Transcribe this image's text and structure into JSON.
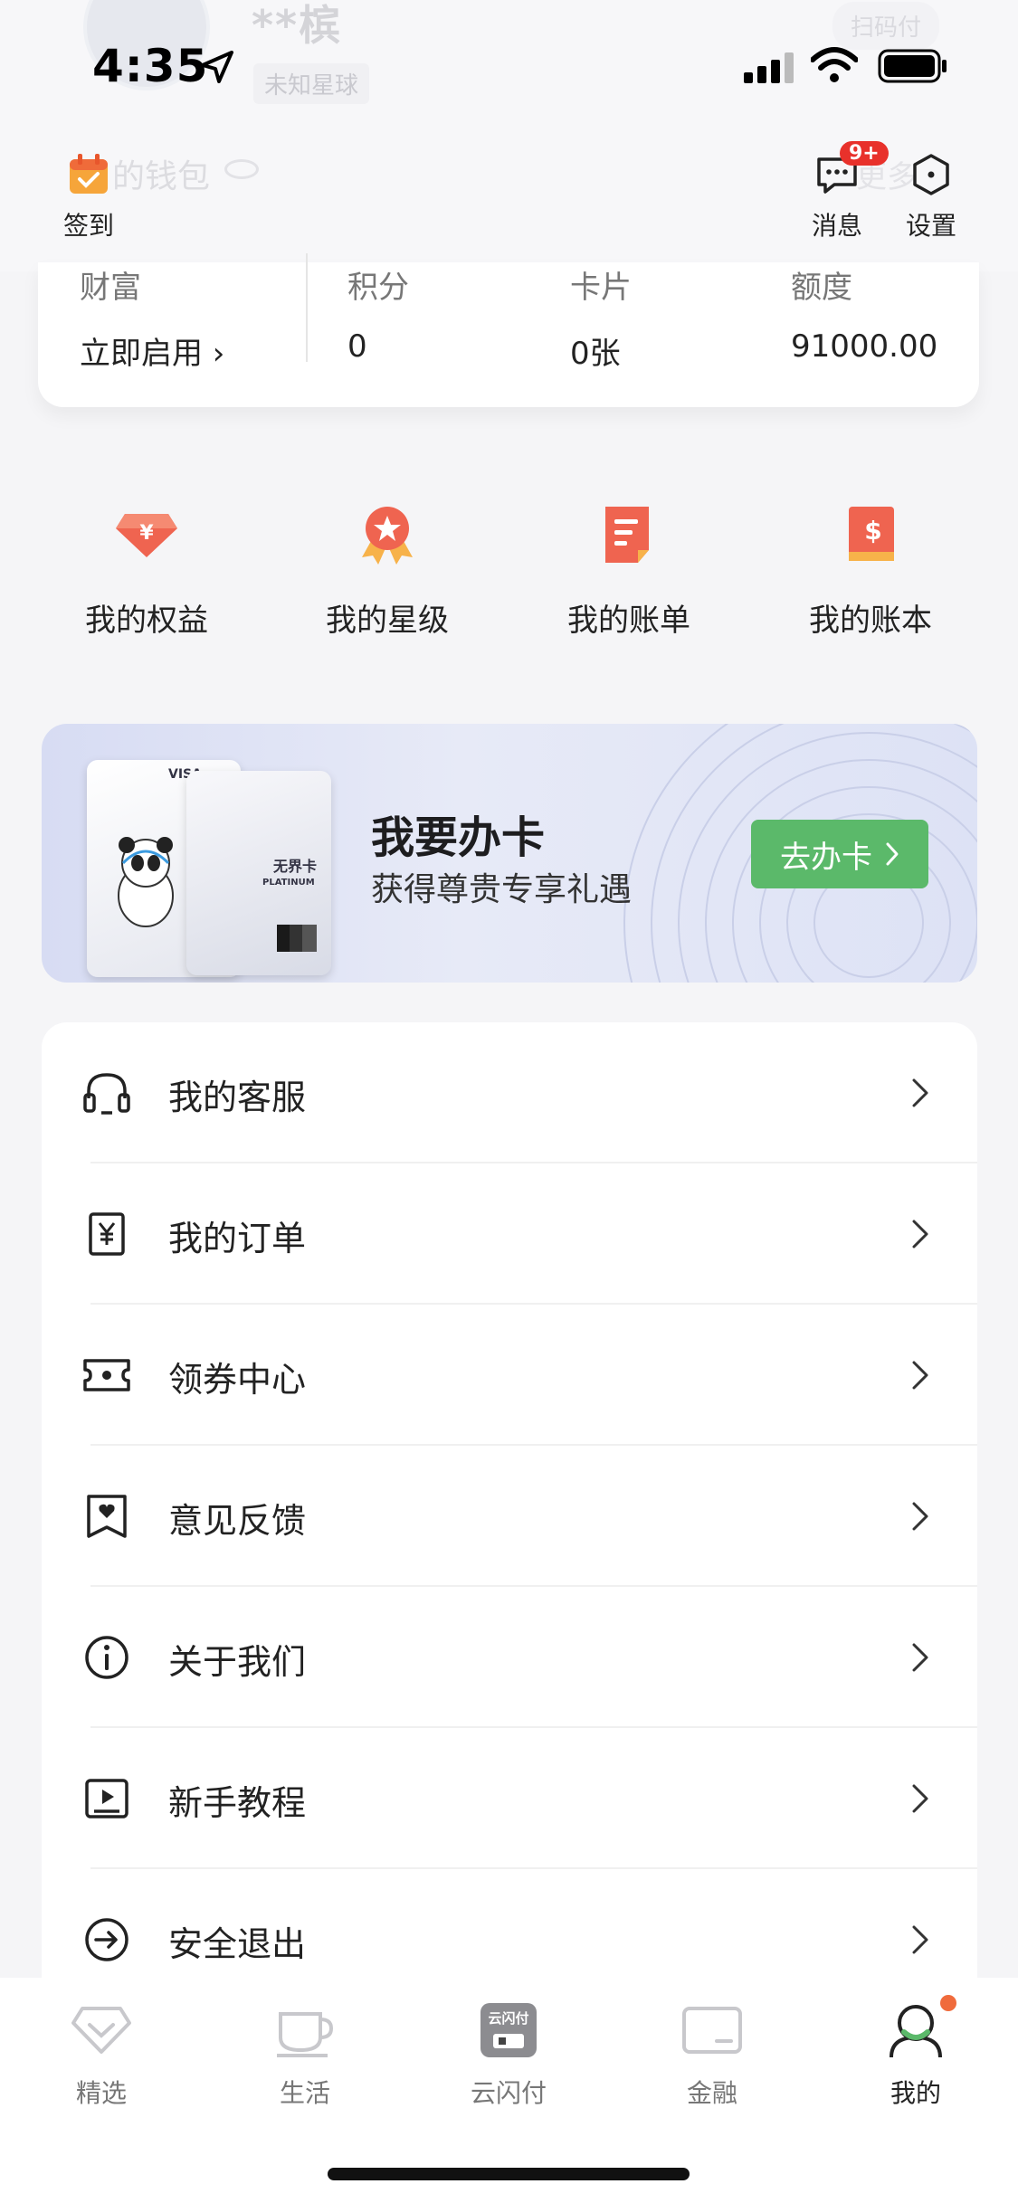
{
  "status_bar": {
    "time": "4:35"
  },
  "ghost_header": {
    "name": "**槟",
    "tag": "未知星球",
    "scan": "扫码付",
    "wallet": "的钱包",
    "more": "更多"
  },
  "top_actions": {
    "checkin": "签到",
    "messages": "消息",
    "messages_badge": "9+",
    "settings": "设置"
  },
  "wallet": {
    "items": [
      {
        "label": "财富",
        "value": "立即启用 ›"
      },
      {
        "label": "积分",
        "value": "0"
      },
      {
        "label": "卡片",
        "value": "0张"
      },
      {
        "label": "额度",
        "value": "91000.00"
      }
    ]
  },
  "shortcuts": [
    {
      "label": "我的权益",
      "icon": "diamond-yen-icon"
    },
    {
      "label": "我的星级",
      "icon": "star-medal-icon"
    },
    {
      "label": "我的账单",
      "icon": "bill-icon"
    },
    {
      "label": "我的账本",
      "icon": "ledger-icon"
    }
  ],
  "banner": {
    "title": "我要办卡",
    "subtitle": "获得尊贵专享礼遇",
    "cta": "去办卡",
    "card_left_text": "VISA",
    "card_right_text": "无界卡",
    "card_right_sub": "PLATINUM"
  },
  "menu": [
    {
      "label": "我的客服",
      "icon": "headset-icon"
    },
    {
      "label": "我的订单",
      "icon": "order-yen-icon"
    },
    {
      "label": "领券中心",
      "icon": "coupon-icon"
    },
    {
      "label": "意见反馈",
      "icon": "feedback-heart-icon"
    },
    {
      "label": "关于我们",
      "icon": "info-icon"
    },
    {
      "label": "新手教程",
      "icon": "tutorial-play-icon"
    },
    {
      "label": "安全退出",
      "icon": "logout-icon"
    }
  ],
  "tabs": [
    {
      "label": "精选",
      "icon": "diamond-tab-icon"
    },
    {
      "label": "生活",
      "icon": "cup-tab-icon"
    },
    {
      "label": "云闪付",
      "icon": "unionpay-tab-icon"
    },
    {
      "label": "金融",
      "icon": "card-tab-icon"
    },
    {
      "label": "我的",
      "icon": "profile-tab-icon",
      "active": true
    }
  ],
  "colors": {
    "accent": "#5bb96a",
    "badge": "#e8312b",
    "shortcut_icon": "#ef6450"
  }
}
